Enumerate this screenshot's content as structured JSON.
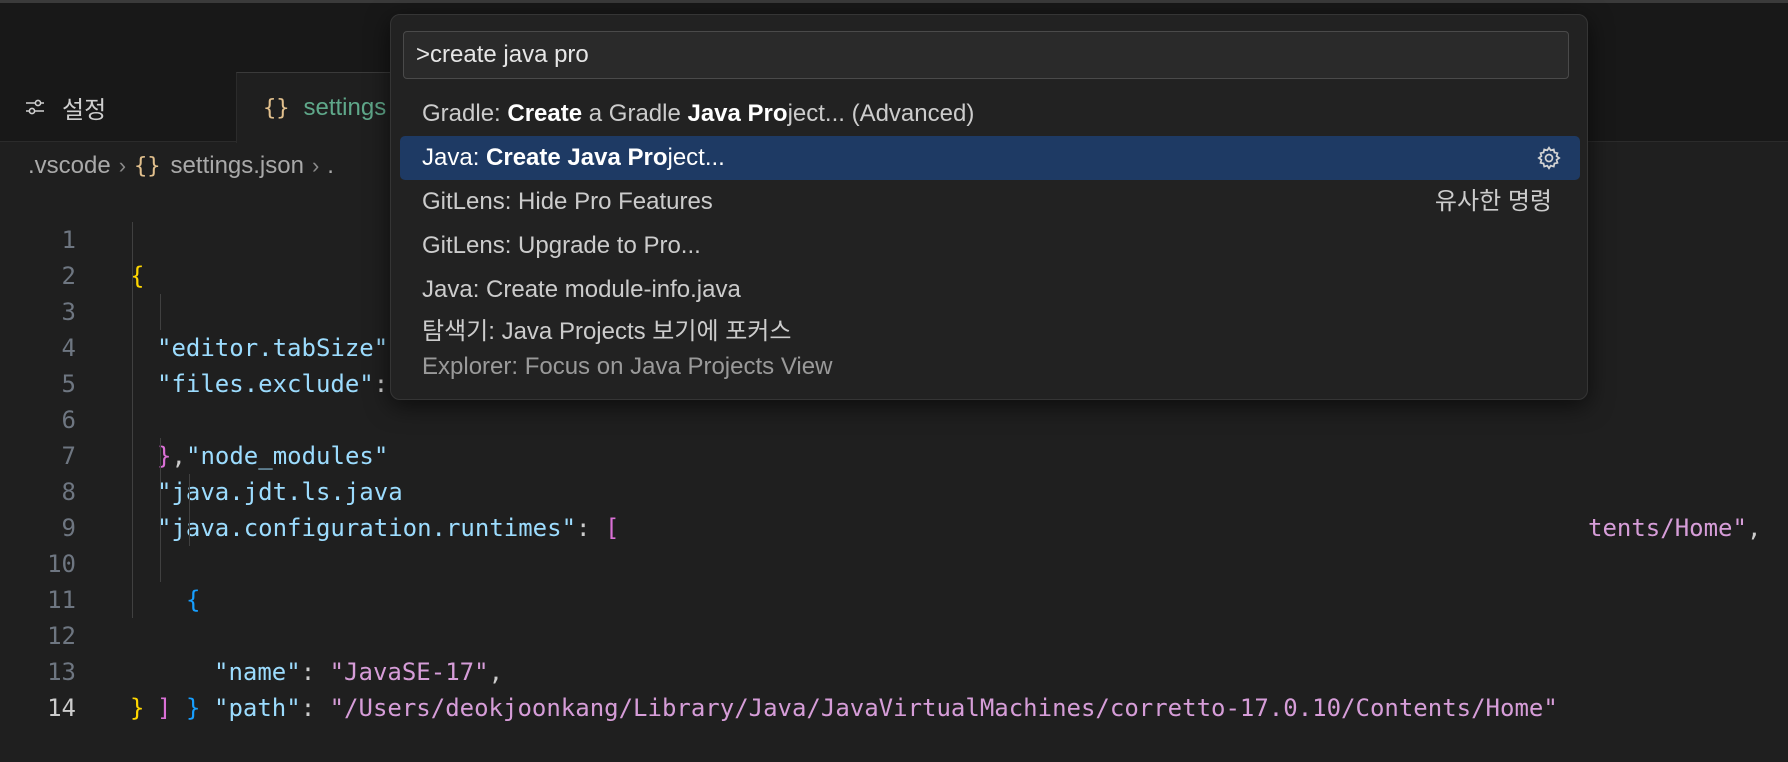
{
  "tabs": {
    "settings_ui_label": "설정",
    "settings_json_label": "settings"
  },
  "breadcrumb": {
    "folder": ".vscode",
    "file": "settings.json",
    "trail": "."
  },
  "editor": {
    "lines": [
      {
        "n": "1"
      },
      {
        "n": "2",
        "key": "\"editor.tabSize\""
      },
      {
        "n": "3",
        "key": "\"files.exclude\"",
        "tail": ":"
      },
      {
        "n": "4",
        "key": "\"node_modules\""
      },
      {
        "n": "5",
        "tail": ","
      },
      {
        "n": "6",
        "key": "\"java.jdt.ls.java",
        "right": "tents/Home\"",
        "right_tail": ","
      },
      {
        "n": "7",
        "key": "\"java.configuration.runtimes\"",
        "tail": ": "
      },
      {
        "n": "8"
      },
      {
        "n": "9",
        "key": "\"name\"",
        "tail": ": ",
        "value": "\"JavaSE-17\"",
        "after": ","
      },
      {
        "n": "10",
        "key": "\"path\"",
        "tail": ": ",
        "value": "\"/Users/deokjoonkang/Library/Java/JavaVirtualMachines/corretto-17.0.10/Contents/Home\""
      },
      {
        "n": "11"
      },
      {
        "n": "12"
      },
      {
        "n": "13"
      },
      {
        "n": "14"
      }
    ]
  },
  "palette": {
    "input_value": ">create java pro",
    "items": [
      {
        "prefix": "Gradle: ",
        "m1": "Create",
        "mid1": " a Gradle ",
        "m2": "Java",
        "mid2": " ",
        "m3": "Pro",
        "rest": "ject... (Advanced)"
      },
      {
        "prefix": "Java: ",
        "m1": "Create",
        "mid1": " ",
        "m2": "Java",
        "mid2": " ",
        "m3": "Pro",
        "rest": "ject..."
      },
      {
        "label": "GitLens: Hide Pro Features",
        "right": "유사한 명령"
      },
      {
        "label": "GitLens: Upgrade to Pro..."
      },
      {
        "label": "Java: Create module-info.java"
      },
      {
        "label": "탐색기: Java Projects 보기에 포커스",
        "sub": "Explorer: Focus on Java Projects View"
      }
    ]
  },
  "colors": {
    "selected_item": "#1e3a64",
    "string_value": "#d69dd8",
    "json_key": "#9cdcfe"
  }
}
